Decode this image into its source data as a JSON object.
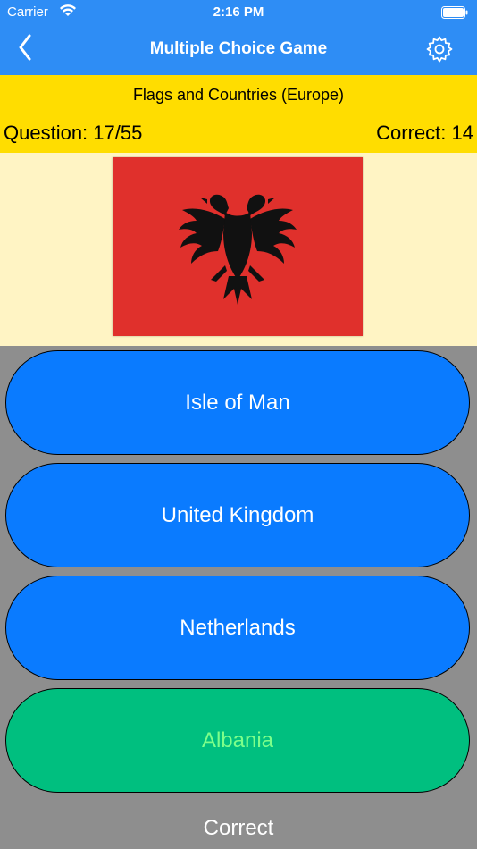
{
  "status_bar": {
    "carrier": "Carrier",
    "time": "2:16 PM"
  },
  "nav": {
    "title": "Multiple Choice Game"
  },
  "quiz": {
    "subtitle": "Flags and Countries (Europe)",
    "question": "Question: 17/55",
    "correct": "Correct: 14"
  },
  "flag": {
    "color": "#e0302c",
    "emblem": "double-headed-eagle"
  },
  "answers": [
    {
      "label": "Isle of Man"
    },
    {
      "label": "United Kingdom"
    },
    {
      "label": "Netherlands"
    },
    {
      "label": "Albania"
    }
  ],
  "feedback": "Correct",
  "colors": {
    "nav": "#2e8df5",
    "banner": "#ffdd00",
    "answer": "#0a7bff",
    "answer_correct": "#00bf7f"
  }
}
